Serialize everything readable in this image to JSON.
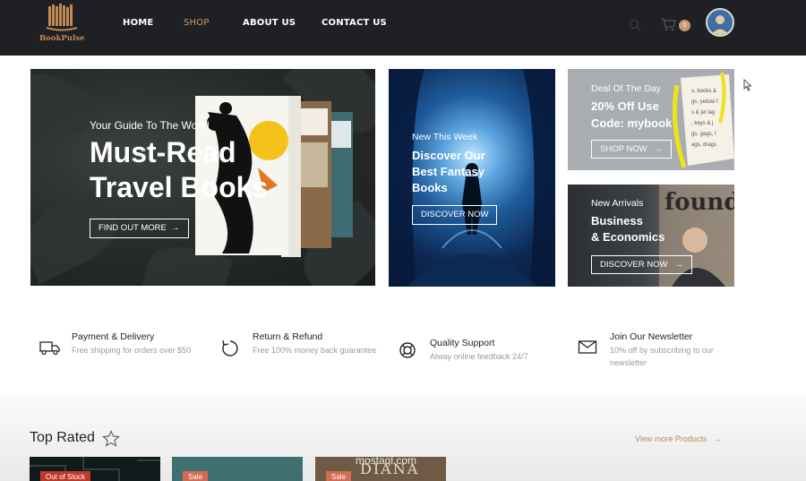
{
  "brand": {
    "name": "BookPulse"
  },
  "nav": {
    "links": [
      {
        "label": "HOME"
      },
      {
        "label": "SHOP"
      },
      {
        "label": "ABOUT US"
      },
      {
        "label": "CONTACT US"
      }
    ],
    "active": "SHOP",
    "cart_count": "0"
  },
  "hero": {
    "subtitle": "Your Guide To The World",
    "title_line1": "Must-Read",
    "title_line2": "Travel Books",
    "button": "FIND OUT MORE",
    "button_icon": "arrow-right-icon"
  },
  "fantasy": {
    "label": "New This Week",
    "title": "Discover Our Best Fantasy Books",
    "button": "DISCOVER NOW"
  },
  "deal": {
    "label": "Deal Of The Day",
    "title_line1": "20% Off Use",
    "title_line2": "Code: mybook",
    "button": "SHOP NOW"
  },
  "business": {
    "label": "New Arrivals",
    "title_line1": "Business",
    "title_line2": "& Economics",
    "button": "DISCOVER NOW"
  },
  "features": [
    {
      "icon": "truck-icon",
      "title": "Payment & Delivery",
      "desc": "Free shipping for orders over $50"
    },
    {
      "icon": "refresh-icon",
      "title": "Return & Refund",
      "desc": "Free 100% money back guarantee"
    },
    {
      "icon": "support-icon",
      "title": "Quality Support",
      "desc": "Alway online feedback 24/7"
    },
    {
      "icon": "mail-icon",
      "title": "Join Our Newsletter",
      "desc": "10% off by subscribing to our newsletter"
    }
  ],
  "top_rated": {
    "title": "Top Rated",
    "view_more": "View more Products",
    "cards": [
      {
        "badge": "Out of Stock"
      },
      {
        "badge": "Sale"
      },
      {
        "badge": "Sale",
        "cover_text": "DIANA"
      }
    ]
  },
  "watermark": "mostaql.com",
  "colors": {
    "nav_bg": "#1f2024",
    "accent": "#c49a74",
    "brand": "#c08a55"
  }
}
